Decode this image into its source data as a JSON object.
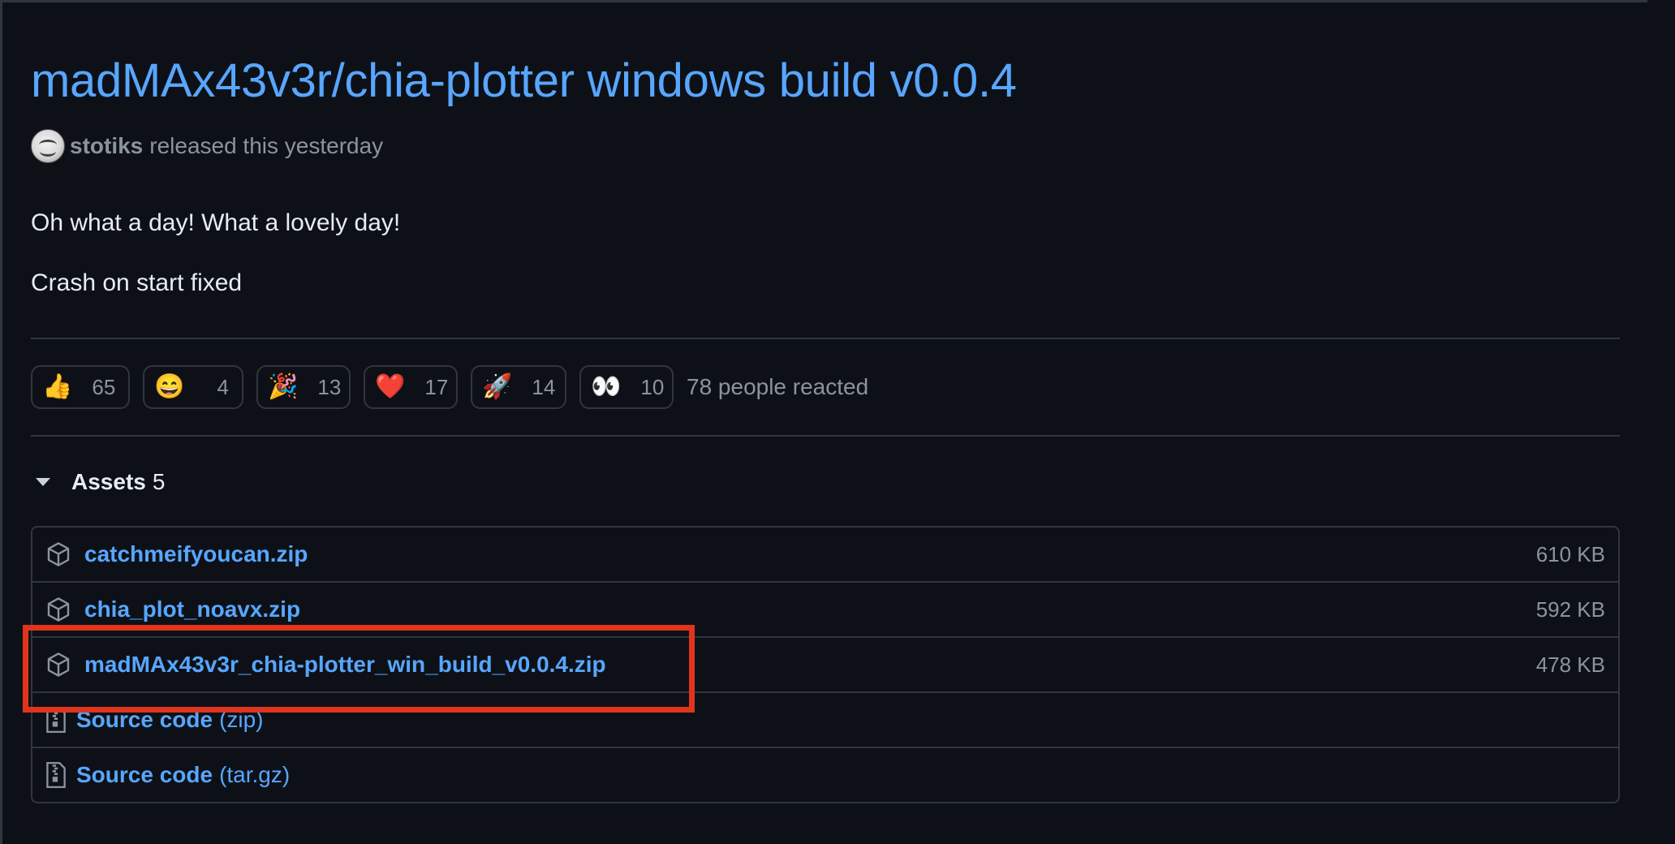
{
  "release": {
    "title": "madMAx43v3r/chia-plotter windows build v0.0.4",
    "author": "stotiks",
    "byline": "released this yesterday",
    "notes": [
      "Oh what a day! What a lovely day!",
      "Crash on start fixed"
    ]
  },
  "reactions": {
    "items": [
      {
        "emoji": "👍",
        "name": "thumbs-up-icon",
        "count": "65"
      },
      {
        "emoji": "😄",
        "name": "laugh-icon",
        "count": "4"
      },
      {
        "emoji": "🎉",
        "name": "hooray-icon",
        "count": "13"
      },
      {
        "emoji": "❤️",
        "name": "heart-icon",
        "count": "17"
      },
      {
        "emoji": "🚀",
        "name": "rocket-icon",
        "count": "14"
      },
      {
        "emoji": "👀",
        "name": "eyes-icon",
        "count": "10"
      }
    ],
    "summary": "78 people reacted"
  },
  "assets": {
    "label": "Assets",
    "count": "5",
    "files": [
      {
        "name": "catchmeifyoucan.zip",
        "size": "610 KB"
      },
      {
        "name": "chia_plot_noavx.zip",
        "size": "592 KB"
      },
      {
        "name": "madMAx43v3r_chia-plotter_win_build_v0.0.4.zip",
        "size": "478 KB"
      }
    ],
    "sources": [
      {
        "label": "Source code",
        "kind": "(zip)"
      },
      {
        "label": "Source code",
        "kind": "(tar.gz)"
      }
    ]
  },
  "colors": {
    "background": "#0d1117",
    "link": "#58a6ff",
    "muted": "#8b949e",
    "border": "#30363d",
    "highlight": "#e0341e"
  }
}
